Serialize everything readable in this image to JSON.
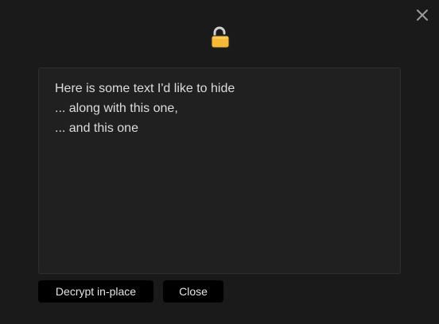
{
  "modal": {
    "close_icon": "close-icon",
    "lock_icon": "unlocked-padlock-icon",
    "lock_color": "#f5b936",
    "text_lines": [
      "Here is some text I'd like to hide",
      "... along with this one,",
      "... and this one"
    ],
    "buttons": {
      "decrypt_label": "Decrypt in-place",
      "close_label": "Close"
    }
  }
}
